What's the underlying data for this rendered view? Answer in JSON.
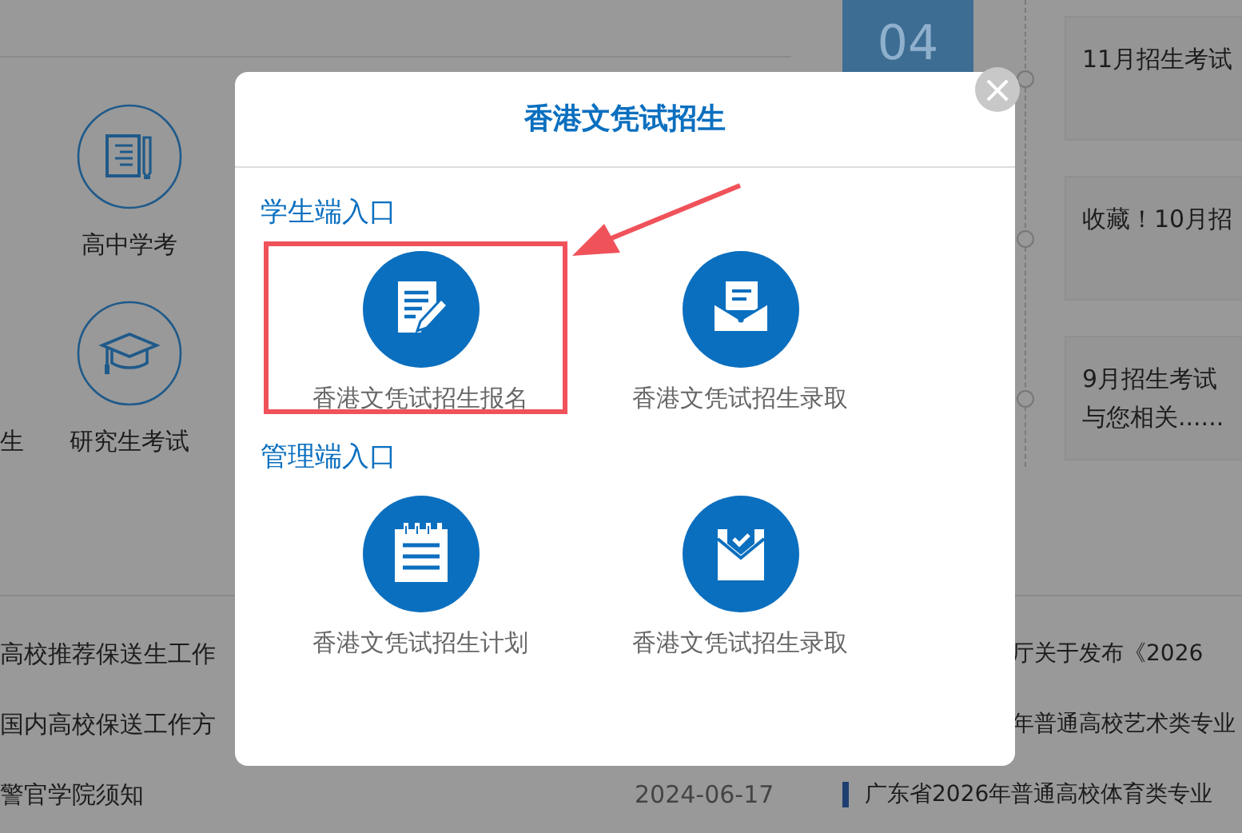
{
  "background": {
    "top_icons": [
      {
        "label": "高中学考",
        "kind": "notebook"
      },
      {
        "label": "研究生考试",
        "kind": "cap"
      }
    ],
    "cut_label": "生",
    "date_box": "04",
    "timeline": [
      {
        "lines": [
          "11月招生考试"
        ]
      },
      {
        "lines": [
          "收藏！10月招"
        ]
      },
      {
        "lines": [
          "9月招生考试",
          "与您相关......"
        ]
      }
    ],
    "news_left": [
      "高校推荐保送生工作",
      "国内高校保送工作方",
      "警官学院须知"
    ],
    "news_date": "2024-06-17",
    "news_right": [
      "厅关于发布《2026",
      "年普通高校艺术类专业",
      "广东省2026年普通高校体育类专业"
    ]
  },
  "modal": {
    "title": "香港文凭试招生",
    "close": "×",
    "sections": [
      {
        "heading": "学生端入口",
        "items": [
          {
            "label": "香港文凭试招生报名",
            "kind": "form",
            "highlighted": true
          },
          {
            "label": "香港文凭试招生录取",
            "kind": "mail",
            "highlighted": false
          }
        ]
      },
      {
        "heading": "管理端入口",
        "items": [
          {
            "label": "香港文凭试招生计划",
            "kind": "notepad",
            "highlighted": false
          },
          {
            "label": "香港文凭试招生录取",
            "kind": "mailcheck",
            "highlighted": false
          }
        ]
      }
    ]
  }
}
